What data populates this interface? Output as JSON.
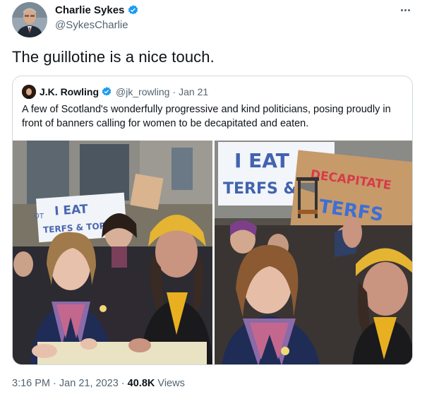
{
  "author": {
    "name": "Charlie Sykes",
    "handle": "@SykesCharlie"
  },
  "tweet_text": "The guillotine is a nice touch.",
  "quoted_tweet": {
    "name": "J.K. Rowling",
    "handle": "@jk_rowling",
    "separator": "·",
    "date": "Jan 21",
    "text": "A few of Scotland's wonderfully progressive and kind politicians, posing proudly in front of banners calling for women to be decapitated and eaten.",
    "photos": {
      "left_sign_text": "I EAT",
      "left_sign_text2": "TERFS & TOR",
      "left_sign_text3": "OT",
      "right_sign_text": "I EAT",
      "right_sign_text2": "TERFS & T",
      "right_sign_text3": "DECAPITATE",
      "right_sign_text4": "TERFS"
    }
  },
  "meta": {
    "time": "3:16 PM",
    "sep1": "·",
    "date": "Jan 21, 2023",
    "sep2": "·",
    "views_count": "40.8K",
    "views_label": "Views"
  },
  "colors": {
    "verified": "#1d9bf0",
    "text": "#0f1419",
    "secondary": "#536471",
    "border": "#cfd9de"
  },
  "icons": [
    "verified-badge-icon",
    "more-options-icon"
  ]
}
